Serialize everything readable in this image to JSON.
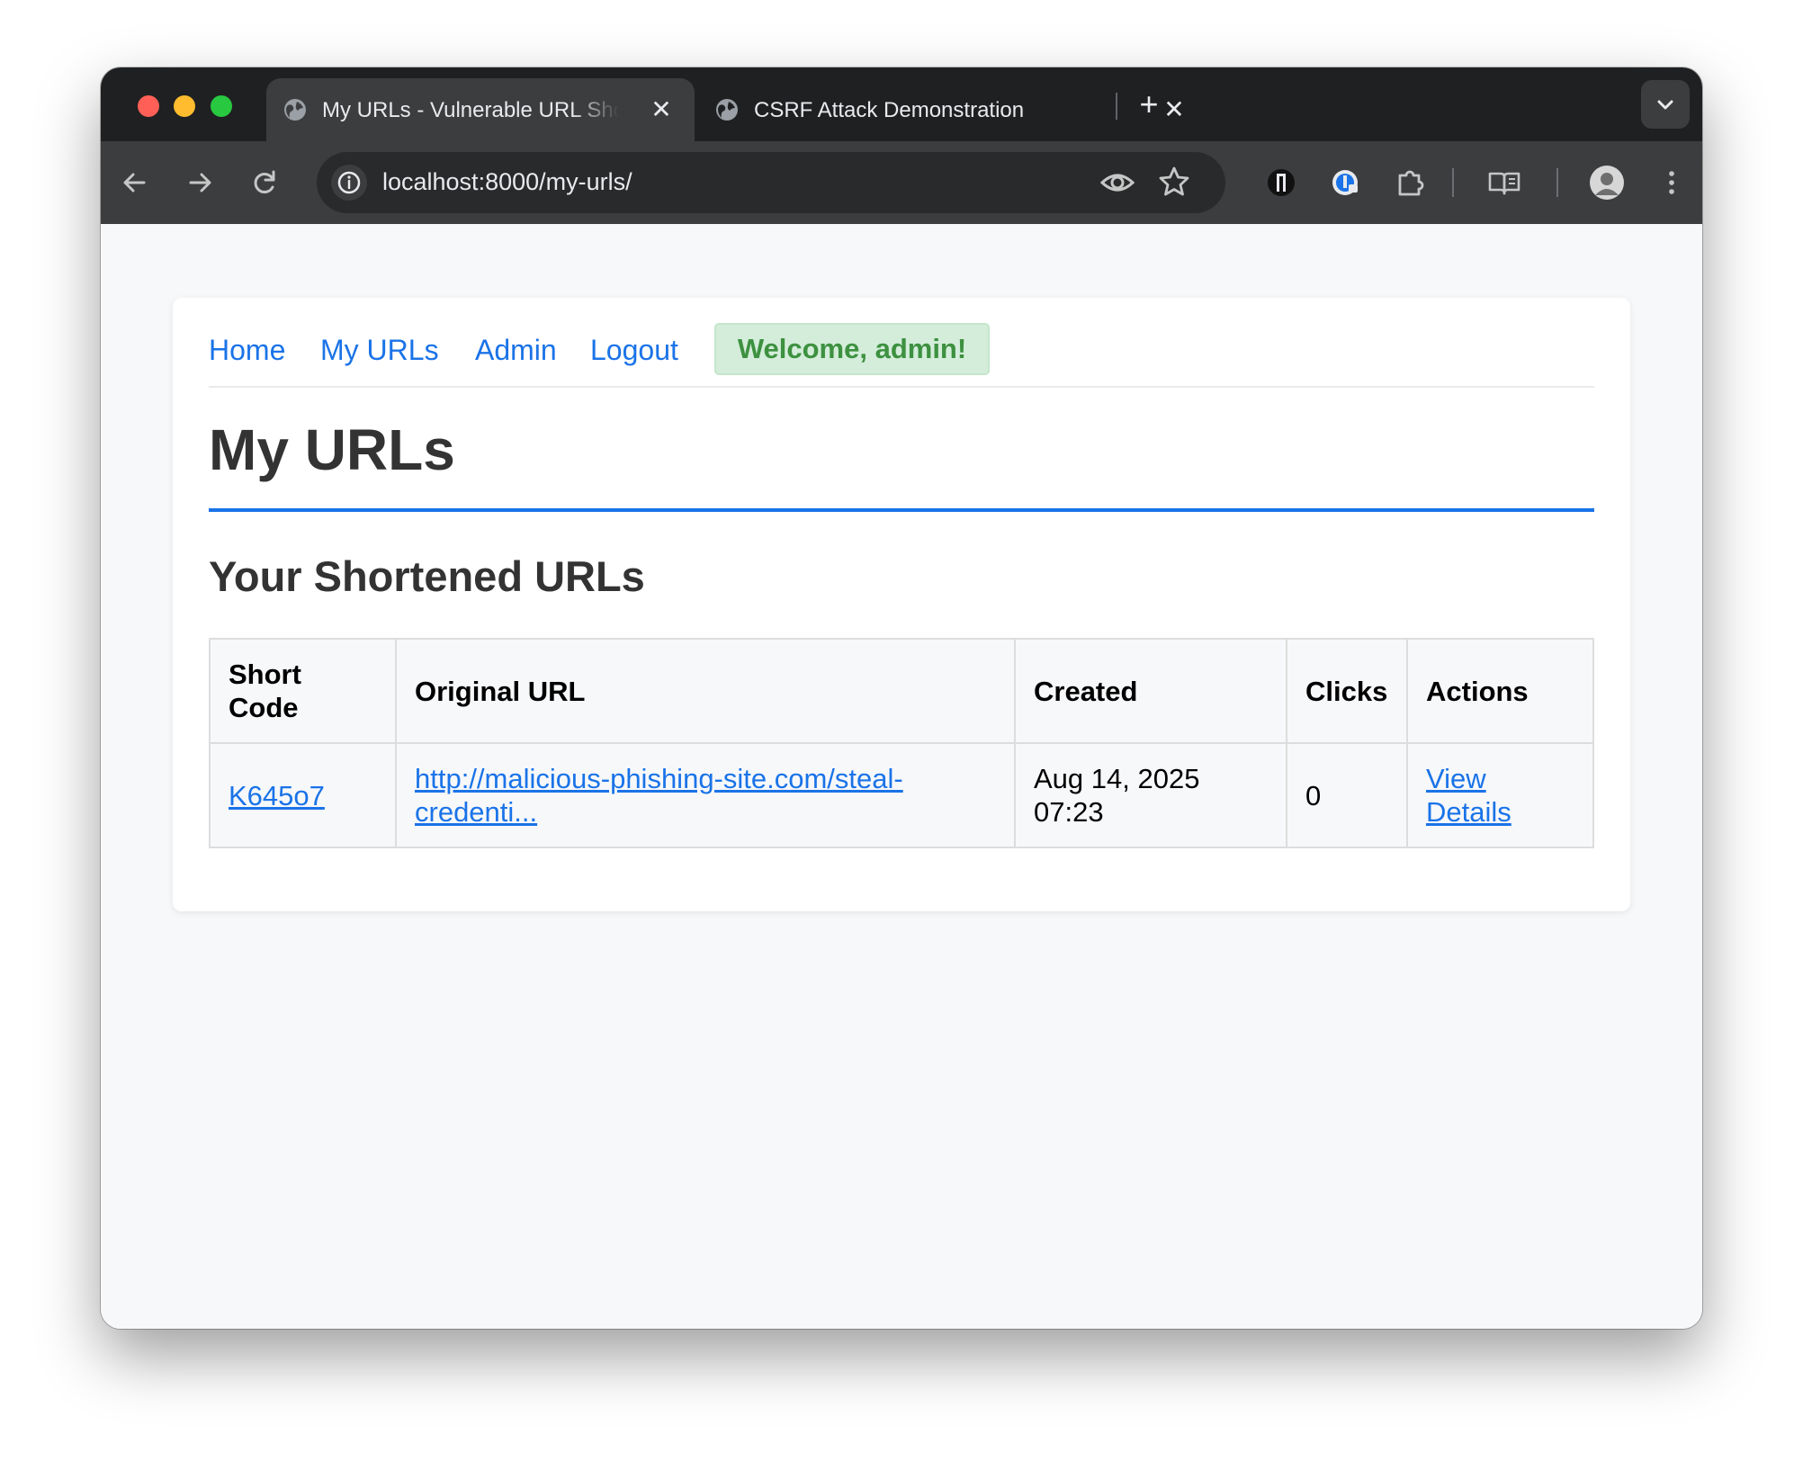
{
  "browser": {
    "tabs": [
      {
        "title": "My URLs - Vulnerable URL Shortener",
        "active": true
      },
      {
        "title": "CSRF Attack Demonstration",
        "active": false
      }
    ],
    "address": "localhost:8000/my-urls/"
  },
  "nav": {
    "links": [
      "Home",
      "My URLs",
      "Admin",
      "Logout"
    ],
    "welcome": "Welcome, admin!"
  },
  "page": {
    "title": "My URLs",
    "section_title": "Your Shortened URLs"
  },
  "table": {
    "headers": [
      "Short Code",
      "Original URL",
      "Created",
      "Clicks",
      "Actions"
    ],
    "rows": [
      {
        "short_code": "K645o7",
        "original_url": "http://malicious-phishing-site.com/steal-credenti...",
        "created": "Aug 14, 2025 07:23",
        "clicks": "0",
        "action": "View Details"
      }
    ]
  },
  "colors": {
    "link": "#1a73e8",
    "welcome_bg": "#d4edda",
    "welcome_text": "#3d9140",
    "chrome_dark": "#1f2022",
    "toolbar": "#3c3d3f"
  },
  "icons": {
    "tab": "globe-icon",
    "back": "arrow-left-icon",
    "forward": "arrow-right-icon",
    "reload": "reload-icon",
    "site_info": "info-icon",
    "tracking": "eye-icon",
    "bookmark": "star-icon",
    "extensions": "puzzle-icon",
    "reading_list": "book-icon",
    "menu": "kebab-menu-icon"
  }
}
